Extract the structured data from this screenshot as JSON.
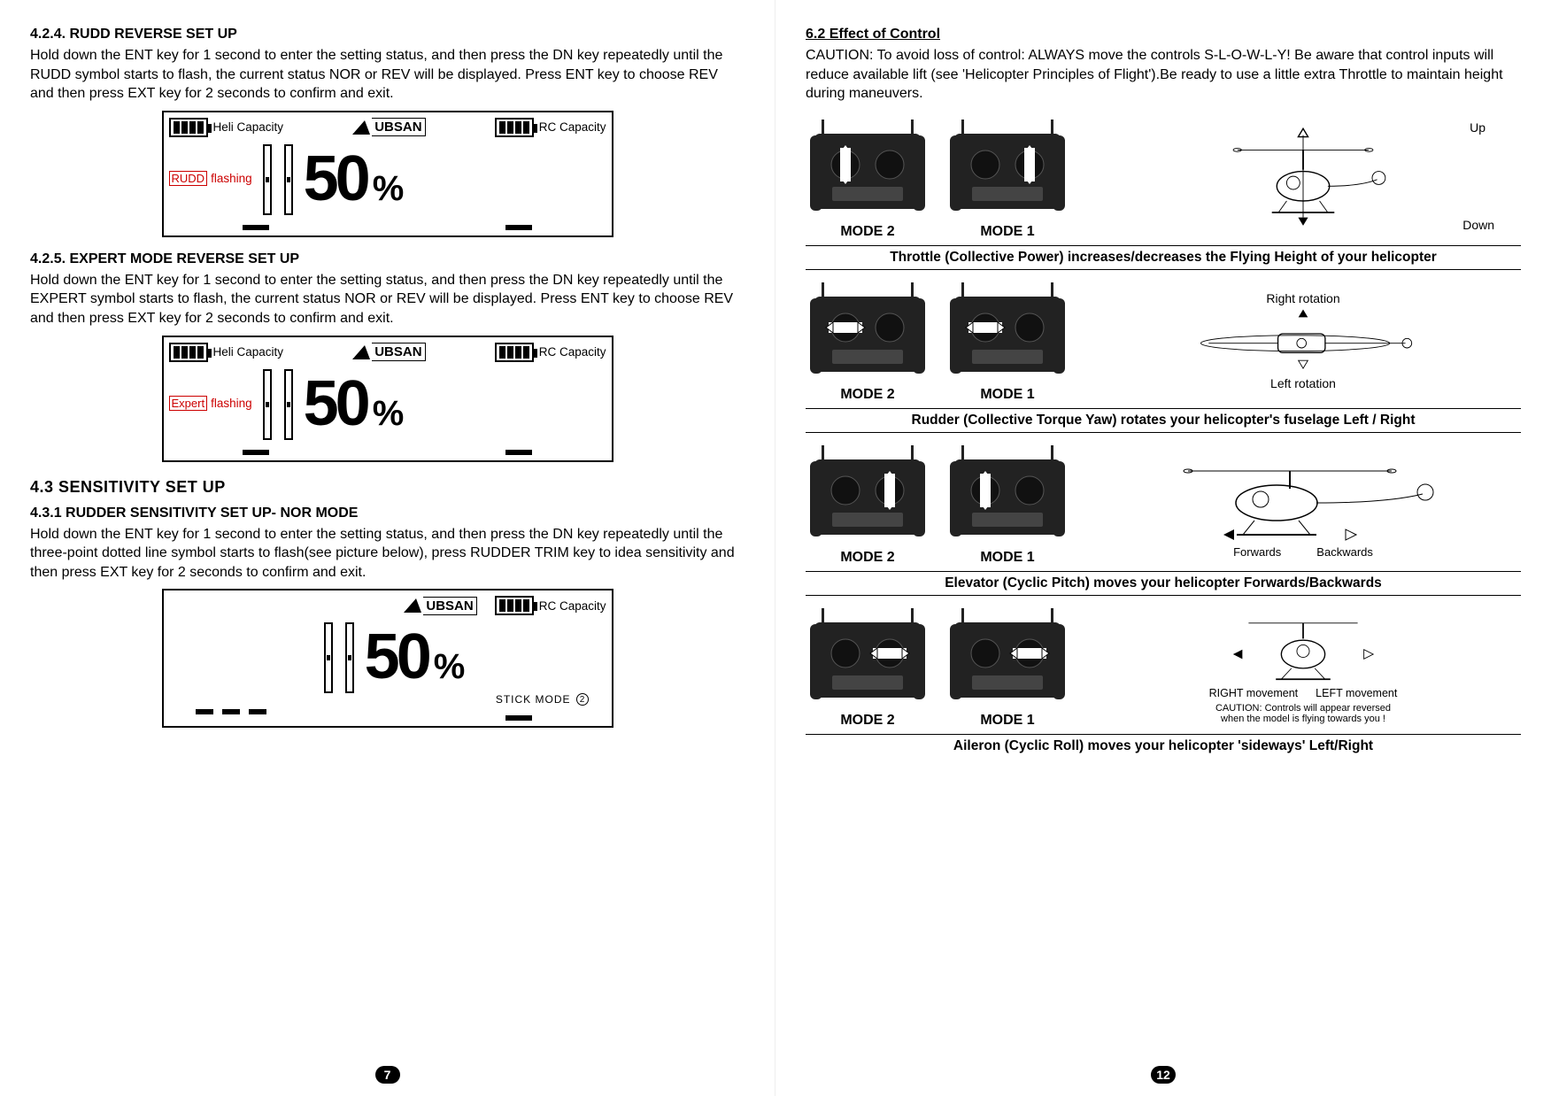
{
  "left": {
    "s424": {
      "title": "4.2.4. RUDD REVERSE SET UP",
      "body": "Hold down the ENT key for 1 second to enter the setting status, and then press the DN key repeatedly until the RUDD symbol starts to flash, the current status NOR or REV will be displayed. Press ENT key to choose REV and then press EXT key for 2 seconds to confirm and exit.",
      "lcd": {
        "heli": "Heli Capacity",
        "brand": "UBSAN",
        "rc": "RC Capacity",
        "tag": "RUDD",
        "flash": "flashing",
        "value": "50",
        "pct": "%"
      }
    },
    "s425": {
      "title": "4.2.5. EXPERT MODE REVERSE SET UP",
      "body": "Hold down the ENT key for 1 second to enter the setting status, and then press the DN key repeatedly until the EXPERT symbol starts to flash, the current status NOR or REV will be displayed. Press ENT key to choose REV and then press EXT key for 2 seconds to confirm and exit.",
      "lcd": {
        "heli": "Heli Capacity",
        "brand": "UBSAN",
        "rc": "RC Capacity",
        "tag": "Expert",
        "flash": "flashing",
        "value": "50",
        "pct": "%"
      }
    },
    "s43head": "4.3     SENSITIVITY SET UP",
    "s431": {
      "title": "4.3.1 RUDDER SENSITIVITY SET UP- NOR MODE",
      "body": "Hold down the ENT key for 1 second to enter the setting status, and then press the DN key repeatedly until the three-point  dotted line symbol starts to flash(see picture below), press RUDDER TRIM key to idea sensitivity and then press EXT key for 2 seconds to confirm and exit.",
      "lcd": {
        "brand": "UBSAN",
        "rc": "RC Capacity",
        "value": "50",
        "pct": "%",
        "stickmode": "STICK MODE",
        "stickn": "2"
      }
    },
    "pagenum": "7"
  },
  "right": {
    "title": "6.2 Effect of Control",
    "caution": "CAUTION: To avoid loss of control: ALWAYS move the controls S-L-O-W-L-Y! Be aware that control inputs will reduce available lift (see 'Helicopter Principles of Flight').Be ready to use a little extra Throttle to maintain height during maneuvers.",
    "rows": [
      {
        "mode2": "MODE 2",
        "mode1": "MODE 1",
        "up": "Up",
        "down": "Down",
        "cap": "Throttle (Collective Power) increases/decreases the Flying Height of your helicopter"
      },
      {
        "mode2": "MODE 2",
        "mode1": "MODE 1",
        "rr": "Right rotation",
        "lr": "Left rotation",
        "cap": "Rudder (Collective Torque Yaw) rotates your helicopter's fuselage Left / Right"
      },
      {
        "mode2": "MODE 2",
        "mode1": "MODE 1",
        "fwd": "Forwards",
        "bwd": "Backwards",
        "cap": "Elevator (Cyclic Pitch) moves your helicopter Forwards/Backwards"
      },
      {
        "mode2": "MODE 2",
        "mode1": "MODE 1",
        "rm": "RIGHT movement",
        "lm": "LEFT movement",
        "note1": "CAUTION: Controls will appear reversed",
        "note2": "when the model is flying towards you !",
        "cap": "Aileron (Cyclic Roll) moves your helicopter 'sideways' Left/Right"
      }
    ],
    "pagenum": "12"
  }
}
